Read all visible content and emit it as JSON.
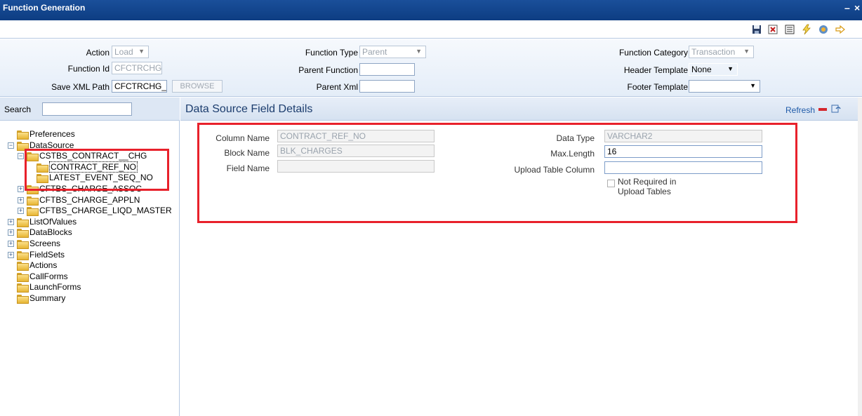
{
  "window": {
    "title": "Function Generation",
    "minimize": "–",
    "close": "×"
  },
  "toolbar": {
    "icons": [
      "save-icon",
      "delete-icon",
      "list-icon",
      "generate-icon",
      "release-icon",
      "exit-icon"
    ]
  },
  "header": {
    "action_label": "Action",
    "action_value": "Load",
    "function_id_label": "Function Id",
    "function_id_value": "CFCTRCHG",
    "save_xml_label": "Save XML Path",
    "save_xml_value": "CFCTRCHG_F",
    "browse_label": "BROWSE",
    "function_type_label": "Function Type",
    "function_type_value": "Parent",
    "parent_function_label": "Parent Function",
    "parent_function_value": "",
    "parent_xml_label": "Parent Xml",
    "parent_xml_value": "",
    "function_category_label": "Function Category",
    "function_category_value": "Transaction",
    "header_template_label": "Header Template",
    "header_template_value": "None",
    "footer_template_label": "Footer Template",
    "footer_template_value": ""
  },
  "search": {
    "label": "Search",
    "value": ""
  },
  "tree": [
    {
      "label": "Preferences",
      "level": 0,
      "expander": ""
    },
    {
      "label": "DataSource",
      "level": 0,
      "expander": "−"
    },
    {
      "label": "CSTBS_CONTRACT__CHG",
      "level": 1,
      "expander": "−"
    },
    {
      "label": "CONTRACT_REF_NO",
      "level": 2,
      "expander": "",
      "selected": true
    },
    {
      "label": "LATEST_EVENT_SEQ_NO",
      "level": 2,
      "expander": ""
    },
    {
      "label": "CFTBS_CHARGE_ASSOC",
      "level": 1,
      "expander": "+"
    },
    {
      "label": "CFTBS_CHARGE_APPLN",
      "level": 1,
      "expander": "+"
    },
    {
      "label": "CFTBS_CHARGE_LIQD_MASTER",
      "level": 1,
      "expander": "+"
    },
    {
      "label": "ListOfValues",
      "level": 0,
      "expander": "+"
    },
    {
      "label": "DataBlocks",
      "level": 0,
      "expander": "+"
    },
    {
      "label": "Screens",
      "level": 0,
      "expander": "+"
    },
    {
      "label": "FieldSets",
      "level": 0,
      "expander": "+"
    },
    {
      "label": "Actions",
      "level": 0,
      "expander": ""
    },
    {
      "label": "CallForms",
      "level": 0,
      "expander": ""
    },
    {
      "label": "LaunchForms",
      "level": 0,
      "expander": ""
    },
    {
      "label": "Summary",
      "level": 0,
      "expander": ""
    }
  ],
  "details": {
    "title": "Data Source Field Details",
    "refresh_label": "Refresh",
    "column_name_label": "Column Name",
    "column_name_value": "CONTRACT_REF_NO",
    "block_name_label": "Block Name",
    "block_name_value": "BLK_CHARGES",
    "field_name_label": "Field Name",
    "field_name_value": "",
    "data_type_label": "Data Type",
    "data_type_value": "VARCHAR2",
    "max_length_label": "Max.Length",
    "max_length_value": "16",
    "upload_table_column_label": "Upload Table Column",
    "upload_table_column_value": "",
    "not_required_label_1": "Not Required in",
    "not_required_label_2": "Upload Tables"
  },
  "colors": {
    "titlebar": "#0d3d82",
    "highlight": "#e8212b"
  }
}
